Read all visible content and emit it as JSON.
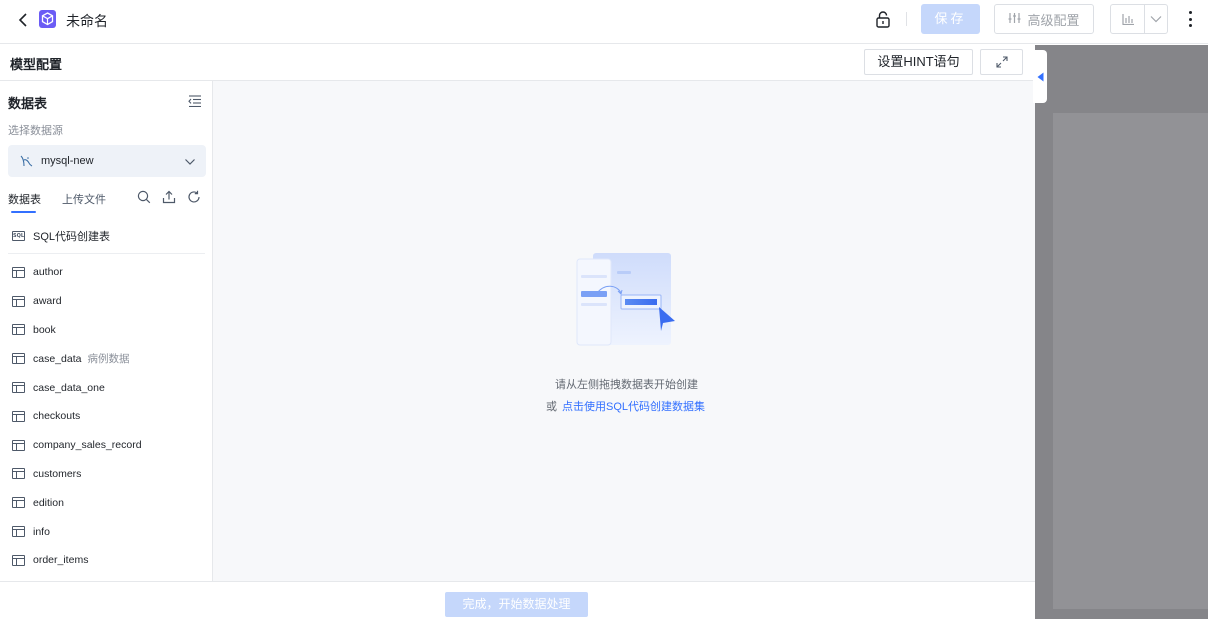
{
  "header": {
    "doc_title": "未命名",
    "save_label": "保存",
    "advanced_label": "高级配置"
  },
  "model": {
    "title": "模型配置",
    "hint_button": "设置HINT语句"
  },
  "sidebar": {
    "title": "数据表",
    "datasource_label": "选择数据源",
    "datasource_value": "mysql-new",
    "tabs": [
      "数据表",
      "上传文件"
    ],
    "sql_create": "SQL代码创建表",
    "sql_icon_text": "SQL",
    "tables": [
      {
        "name": "author",
        "desc": ""
      },
      {
        "name": "award",
        "desc": ""
      },
      {
        "name": "book",
        "desc": ""
      },
      {
        "name": "case_data",
        "desc": "病例数据"
      },
      {
        "name": "case_data_one",
        "desc": ""
      },
      {
        "name": "checkouts",
        "desc": ""
      },
      {
        "name": "company_sales_record",
        "desc": ""
      },
      {
        "name": "customers",
        "desc": ""
      },
      {
        "name": "edition",
        "desc": ""
      },
      {
        "name": "info",
        "desc": ""
      },
      {
        "name": "order_items",
        "desc": ""
      }
    ]
  },
  "canvas": {
    "empty_text": "请从左侧拖拽数据表开始创建",
    "or_text": "或",
    "sql_link": "点击使用SQL代码创建数据集"
  },
  "footer": {
    "finish_button": "完成，开始数据处理"
  },
  "colors": {
    "accent": "#3370ff",
    "disabled_primary": "#c5d7fb",
    "overlay_panel": "#858589"
  },
  "icons": [
    "back-arrow-icon",
    "app-logo-icon",
    "lock-icon",
    "sliders-icon",
    "bar-chart-icon",
    "chevron-down-icon",
    "more-vertical-icon",
    "expand-icon",
    "collapse-list-icon",
    "database-icon",
    "search-icon",
    "upload-icon",
    "refresh-icon",
    "sql-icon",
    "table-icon",
    "caret-left-icon"
  ]
}
